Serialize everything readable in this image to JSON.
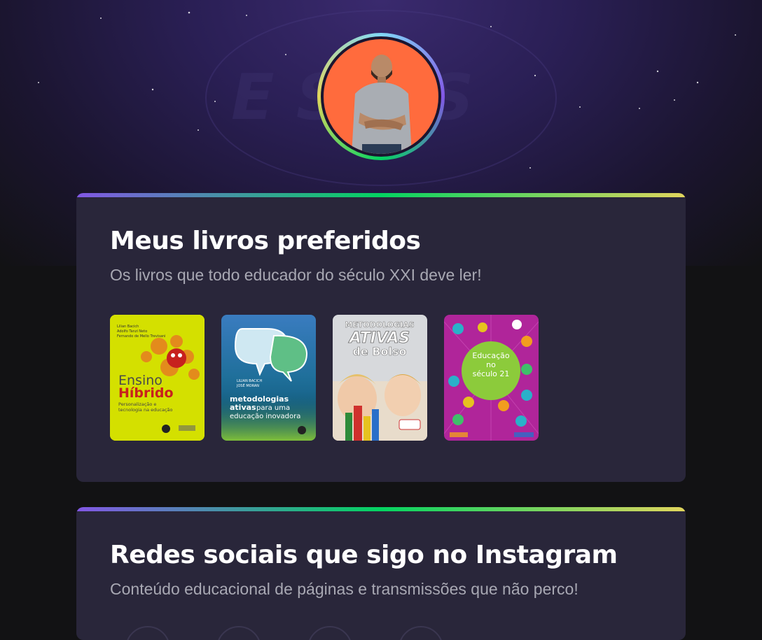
{
  "profile": {
    "avatar_icon": "person-avatar-icon",
    "accent_bg": "#ff6b3d"
  },
  "books_section": {
    "title": "Meus livros preferidos",
    "subtitle": "Os livros que todo educador do século XXI deve ler!",
    "books": [
      {
        "authors": "Lilian Bacich\nAdolfo Tanzi Neto\nFernando de Mello Trevisani",
        "title_line1": "Ensino",
        "title_line2": "Híbrido",
        "subtitle": "Personalização e tecnologia na educação",
        "color": "#d4e000"
      },
      {
        "authors": "LILIAN BACICH\nJOSÉ MORAN",
        "title_line1": "metodologias",
        "title_line2": "ativas",
        "title_rest": "para uma educação inovadora",
        "color": "#1f6f9a"
      },
      {
        "title_line1": "METODOLOGIAS",
        "title_line2": "ATIVAS",
        "title_line3": "de Bolso",
        "color": "#d0d3d6"
      },
      {
        "title_line1": "Educação",
        "title_line2": "no",
        "title_line3": "século 21",
        "color": "#b0259a"
      }
    ]
  },
  "social_section": {
    "title": "Redes sociais que sigo no Instagram",
    "subtitle": "Conteúdo educacional de páginas e transmissões que não perco!"
  },
  "colors": {
    "gradient_start": "#8257e5",
    "gradient_mid": "#04d361",
    "gradient_end": "#e1d55d",
    "card_bg": "#29263a",
    "page_bg": "#121214"
  }
}
